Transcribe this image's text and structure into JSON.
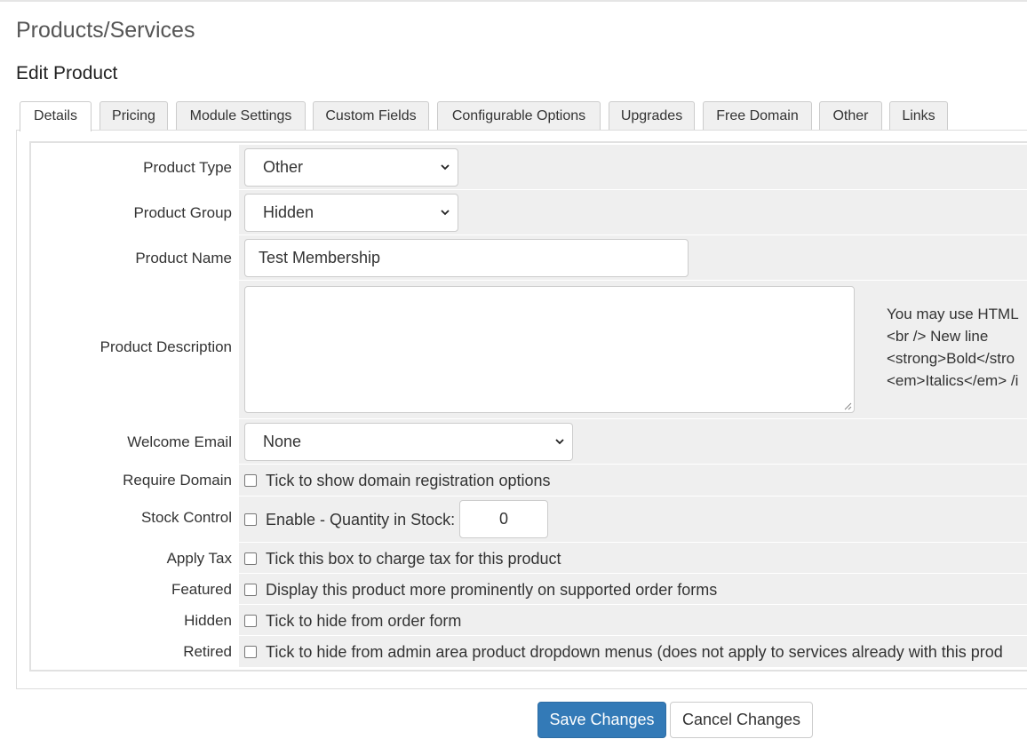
{
  "header": {
    "page_title": "Products/Services",
    "section_title": "Edit Product"
  },
  "tabs": [
    {
      "label": "Details",
      "active": true
    },
    {
      "label": "Pricing"
    },
    {
      "label": "Module Settings"
    },
    {
      "label": "Custom Fields"
    },
    {
      "label": "Configurable Options"
    },
    {
      "label": "Upgrades"
    },
    {
      "label": "Free Domain"
    },
    {
      "label": "Other"
    },
    {
      "label": "Links"
    }
  ],
  "form": {
    "product_type": {
      "label": "Product Type",
      "value": "Other"
    },
    "product_group": {
      "label": "Product Group",
      "value": "Hidden"
    },
    "product_name": {
      "label": "Product Name",
      "value": "Test Membership"
    },
    "product_description": {
      "label": "Product Description",
      "value": "",
      "hint_lines": [
        "You may use HTML",
        "<br /> New line",
        "<strong>Bold</stro",
        "<em>Italics</em> /i"
      ]
    },
    "welcome_email": {
      "label": "Welcome Email",
      "value": "None"
    },
    "require_domain": {
      "label": "Require Domain",
      "text": "Tick to show domain registration options",
      "checked": false
    },
    "stock_control": {
      "label": "Stock Control",
      "text": "Enable - Quantity in Stock:",
      "checked": false,
      "quantity": "0"
    },
    "apply_tax": {
      "label": "Apply Tax",
      "text": "Tick this box to charge tax for this product",
      "checked": false
    },
    "featured": {
      "label": "Featured",
      "text": "Display this product more prominently on supported order forms",
      "checked": false
    },
    "hidden": {
      "label": "Hidden",
      "text": "Tick to hide from order form",
      "checked": false
    },
    "retired": {
      "label": "Retired",
      "text": "Tick to hide from admin area product dropdown menus (does not apply to services already with this prod",
      "checked": false
    }
  },
  "actions": {
    "save_label": "Save Changes",
    "cancel_label": "Cancel Changes"
  },
  "colors": {
    "primary": "#337ab7",
    "field_background": "#efefef"
  },
  "icons": {
    "select_arrow": "chevron-down-icon",
    "textarea_resize": "resize-handle-icon"
  }
}
